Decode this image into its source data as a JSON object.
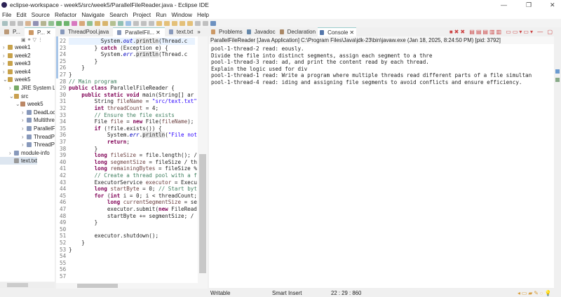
{
  "window": {
    "title": "eclipse-workspace - week5/src/week5/ParallelFileReader.java - Eclipse IDE"
  },
  "menu": [
    "File",
    "Edit",
    "Source",
    "Refactor",
    "Navigate",
    "Search",
    "Project",
    "Run",
    "Window",
    "Help"
  ],
  "left_tabs": [
    "P...",
    "P..."
  ],
  "tree": [
    {
      "label": "week1",
      "indent": 0,
      "icon": "project-icon"
    },
    {
      "label": "week2",
      "indent": 0,
      "icon": "project-icon"
    },
    {
      "label": "week3",
      "indent": 0,
      "icon": "project-icon"
    },
    {
      "label": "week4",
      "indent": 0,
      "icon": "project-icon"
    },
    {
      "label": "week5",
      "indent": 0,
      "icon": "project-icon"
    },
    {
      "label": "JRE System Lib",
      "indent": 1,
      "icon": "library-icon"
    },
    {
      "label": "src",
      "indent": 1,
      "icon": "folder-icon"
    },
    {
      "label": "week5",
      "indent": 2,
      "icon": "package-icon"
    },
    {
      "label": "DeadLoc",
      "indent": 3,
      "icon": "java-file-icon"
    },
    {
      "label": "Multithre",
      "indent": 3,
      "icon": "java-file-icon"
    },
    {
      "label": "ParallelFi",
      "indent": 3,
      "icon": "java-file-icon"
    },
    {
      "label": "ThreadPo",
      "indent": 3,
      "icon": "java-file-icon"
    },
    {
      "label": "ThreadPo",
      "indent": 3,
      "icon": "java-file-icon"
    },
    {
      "label": "module-info",
      "indent": 1,
      "icon": "java-file-icon"
    },
    {
      "label": "text.txt",
      "indent": 1,
      "icon": "text-file-icon"
    }
  ],
  "editor_tabs": [
    {
      "label": "ThreadPool.java",
      "active": false
    },
    {
      "label": "ParallelFil...",
      "active": true
    },
    {
      "label": "text.txt",
      "active": false
    }
  ],
  "editor_overflow": "»",
  "code": [
    {
      "n": "22",
      "t": [
        [
          "          System.",
          ""
        ],
        [
          "out",
          "fd"
        ],
        [
          ".",
          ""
        ],
        [
          "println",
          "me"
        ],
        [
          "(Thread.c",
          ""
        ]
      ]
    },
    {
      "n": "23",
      "t": [
        [
          "        } ",
          ""
        ],
        [
          "catch",
          "kw"
        ],
        [
          " (Exception e) {",
          ""
        ]
      ]
    },
    {
      "n": "24",
      "t": [
        [
          "          System.",
          ""
        ],
        [
          "err",
          "fd"
        ],
        [
          ".",
          ""
        ],
        [
          "println",
          "me"
        ],
        [
          "(Thread.c",
          ""
        ]
      ]
    },
    {
      "n": "25",
      "t": [
        [
          "        }",
          ""
        ]
      ]
    },
    {
      "n": "26",
      "t": [
        [
          "    }",
          ""
        ]
      ]
    },
    {
      "n": "27",
      "t": [
        [
          "}",
          ""
        ]
      ]
    },
    {
      "n": "28",
      "t": [
        [
          "// Main program",
          "cm"
        ]
      ]
    },
    {
      "n": "29",
      "t": [
        [
          "public class",
          "kw"
        ],
        [
          " ParallelFileReader {",
          ""
        ]
      ]
    },
    {
      "n": "30",
      "t": [
        [
          "    ",
          "kw"
        ],
        [
          "public static void",
          "kw"
        ],
        [
          " main(String[] ar",
          ""
        ]
      ]
    },
    {
      "n": "31",
      "t": [
        [
          "        String ",
          ""
        ],
        [
          "fileName",
          "vr"
        ],
        [
          " = ",
          ""
        ],
        [
          "\"src/text.txt\"",
          "st"
        ]
      ]
    },
    {
      "n": "32",
      "t": [
        [
          "        ",
          ""
        ],
        [
          "int",
          "kw"
        ],
        [
          " ",
          ""
        ],
        [
          "threadCount",
          "vr"
        ],
        [
          " = 4;",
          ""
        ]
      ]
    },
    {
      "n": "33",
      "t": [
        [
          "        // Ensure the file exists",
          "cm"
        ]
      ]
    },
    {
      "n": "34",
      "t": [
        [
          "        File ",
          ""
        ],
        [
          "file",
          "vr"
        ],
        [
          " = ",
          ""
        ],
        [
          "new",
          "kw"
        ],
        [
          " File(",
          ""
        ],
        [
          "fileName",
          "vr"
        ],
        [
          ");",
          ""
        ]
      ]
    },
    {
      "n": "35",
      "t": [
        [
          "        ",
          ""
        ],
        [
          "if",
          "kw"
        ],
        [
          " (!file.exists()) {",
          ""
        ]
      ]
    },
    {
      "n": "36",
      "t": [
        [
          "            System.",
          ""
        ],
        [
          "err",
          "fd"
        ],
        [
          ".",
          ""
        ],
        [
          "println",
          "me"
        ],
        [
          "(",
          ""
        ],
        [
          "\"File not",
          "st"
        ]
      ]
    },
    {
      "n": "37",
      "t": [
        [
          "            ",
          ""
        ],
        [
          "return",
          "kw"
        ],
        [
          ";",
          ""
        ]
      ]
    },
    {
      "n": "38",
      "t": [
        [
          "        }",
          ""
        ]
      ]
    },
    {
      "n": "39",
      "t": [
        [
          "        ",
          ""
        ],
        [
          "long",
          "kw"
        ],
        [
          " ",
          ""
        ],
        [
          "fileSize",
          "vr"
        ],
        [
          " = file.length(); /",
          ""
        ]
      ]
    },
    {
      "n": "40",
      "t": [
        [
          "        ",
          ""
        ],
        [
          "long",
          "kw"
        ],
        [
          " ",
          ""
        ],
        [
          "segmentSize",
          "vr"
        ],
        [
          " = fileSize / th",
          ""
        ]
      ]
    },
    {
      "n": "41",
      "t": [
        [
          "        ",
          ""
        ],
        [
          "long",
          "kw"
        ],
        [
          " ",
          ""
        ],
        [
          "remainingBytes",
          "vr"
        ],
        [
          " = fileSize %",
          ""
        ]
      ]
    },
    {
      "n": "42",
      "t": [
        [
          "        // Create a thread pool with a f",
          "cm"
        ]
      ]
    },
    {
      "n": "43",
      "t": [
        [
          "        ExecutorService ",
          ""
        ],
        [
          "executor",
          "vr"
        ],
        [
          " = Execu",
          ""
        ]
      ]
    },
    {
      "n": "44",
      "t": [
        [
          "        ",
          ""
        ],
        [
          "long",
          "kw"
        ],
        [
          " ",
          ""
        ],
        [
          "startByte",
          "vr"
        ],
        [
          " = 0; ",
          ""
        ],
        [
          "// Start byt",
          "cm"
        ]
      ]
    },
    {
      "n": "45",
      "t": [
        [
          "        ",
          ""
        ],
        [
          "for",
          "kw"
        ],
        [
          " (",
          ""
        ],
        [
          "int",
          "kw"
        ],
        [
          " i = 0; i < threadCount;",
          ""
        ]
      ]
    },
    {
      "n": "46",
      "t": [
        [
          "            ",
          ""
        ],
        [
          "long",
          "kw"
        ],
        [
          " ",
          ""
        ],
        [
          "currentSegmentSize",
          "vr"
        ],
        [
          " = se",
          ""
        ]
      ]
    },
    {
      "n": "47",
      "t": [
        [
          "            executor.submit(",
          ""
        ],
        [
          "new",
          "kw"
        ],
        [
          " FileRead",
          ""
        ]
      ]
    },
    {
      "n": "48",
      "t": [
        [
          "            startByte += segmentSize; /",
          ""
        ]
      ]
    },
    {
      "n": "49",
      "t": [
        [
          "        }",
          ""
        ]
      ]
    },
    {
      "n": "50",
      "t": [
        [
          "",
          ""
        ]
      ]
    },
    {
      "n": "51",
      "t": [
        [
          "        executor.shutdown();",
          ""
        ]
      ]
    },
    {
      "n": "52",
      "t": [
        [
          "    }",
          ""
        ]
      ]
    },
    {
      "n": "53",
      "t": [
        [
          "}",
          ""
        ]
      ]
    },
    {
      "n": "54",
      "t": [
        [
          "",
          ""
        ]
      ]
    },
    {
      "n": "55",
      "t": [
        [
          "",
          ""
        ]
      ]
    },
    {
      "n": "56",
      "t": [
        [
          "",
          ""
        ]
      ]
    },
    {
      "n": "57",
      "t": [
        [
          "",
          ""
        ]
      ]
    }
  ],
  "console_tabs": [
    "Problems",
    "Javadoc",
    "Declaration",
    "Console"
  ],
  "console": {
    "header": "ParallelFileReader [Java Application] C:\\Program Files\\Java\\jdk-23\\bin\\javaw.exe  (Jan 18, 2025, 8:24:50 PM) [pid: 3792]",
    "lines": [
      "pool-1-thread-2 read: eously.",
      "Divide the file into distinct segments, assign each segment to a thre",
      "pool-1-thread-3 read: ad, and print the content read by each thread.",
      "Explain the logic used for div",
      "pool-1-thread-1 read: Write a program where multiple threads read different parts of a file simultan",
      "pool-1-thread-4 read: iding and assigning file segments to avoid conflicts and ensure efficiency."
    ]
  },
  "status": {
    "mode": "Writable",
    "insert": "Smart Insert",
    "position": "22 : 29 : 860"
  }
}
